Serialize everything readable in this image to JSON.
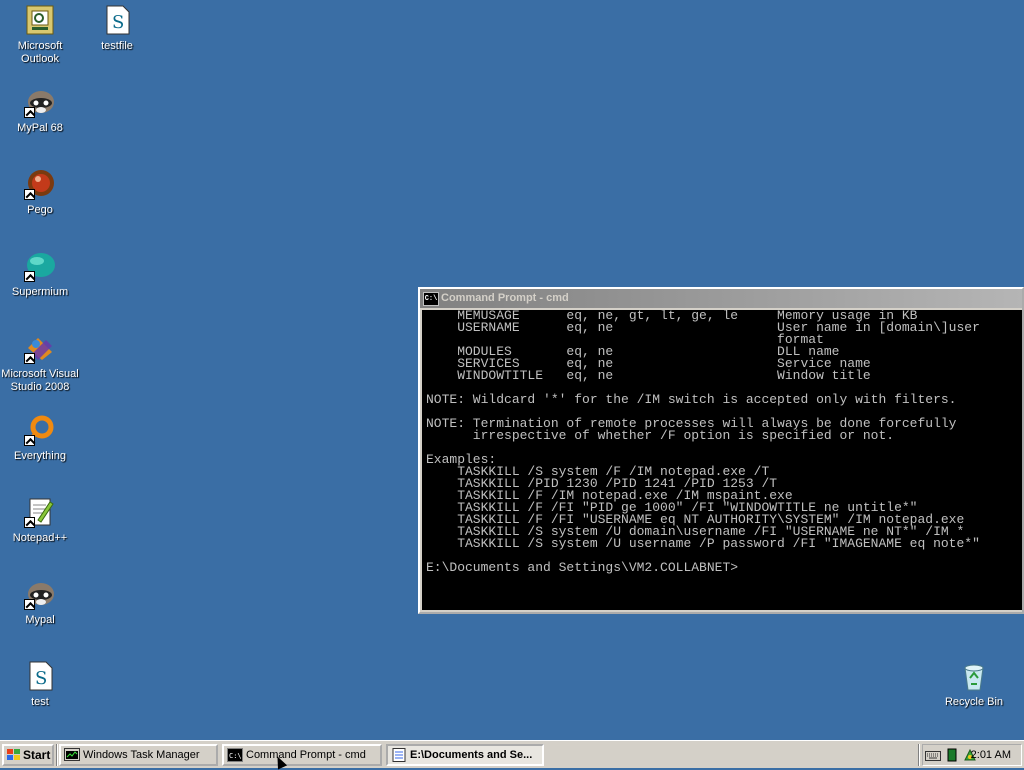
{
  "desktop": {
    "background": "#3a6ea5",
    "icons": [
      {
        "label": "Microsoft Outlook",
        "icon": "outlook-icon"
      },
      {
        "label": "testfile",
        "icon": "script-file-icon"
      },
      {
        "label": "MyPal 68",
        "icon": "mypal-raccoon-icon"
      },
      {
        "label": "Pego",
        "icon": "pego-icon"
      },
      {
        "label": "Supermium",
        "icon": "supermium-icon"
      },
      {
        "label": "Microsoft Visual Studio 2008",
        "icon": "visual-studio-icon"
      },
      {
        "label": "Everything",
        "icon": "everything-search-icon"
      },
      {
        "label": "Notepad++",
        "icon": "notepadpp-icon"
      },
      {
        "label": "Mypal",
        "icon": "mypal-raccoon-icon"
      },
      {
        "label": "test",
        "icon": "script-file-icon"
      },
      {
        "label": "Recycle Bin",
        "icon": "recycle-bin-icon"
      }
    ]
  },
  "cmd_window": {
    "title": "Command Prompt - cmd",
    "icon_text": "C:\\",
    "lines": [
      "    MEMUSAGE      eq, ne, gt, lt, ge, le     Memory usage in KB",
      "    USERNAME      eq, ne                     User name in [domain\\]user",
      "                                             format",
      "    MODULES       eq, ne                     DLL name",
      "    SERVICES      eq, ne                     Service name",
      "    WINDOWTITLE   eq, ne                     Window title",
      "",
      "NOTE: Wildcard '*' for the /IM switch is accepted only with filters.",
      "",
      "NOTE: Termination of remote processes will always be done forcefully",
      "      irrespective of whether /F option is specified or not.",
      "",
      "Examples:",
      "    TASKKILL /S system /F /IM notepad.exe /T",
      "    TASKKILL /PID 1230 /PID 1241 /PID 1253 /T",
      "    TASKKILL /F /IM notepad.exe /IM mspaint.exe",
      "    TASKKILL /F /FI \"PID ge 1000\" /FI \"WINDOWTITLE ne untitle*\"",
      "    TASKKILL /F /FI \"USERNAME eq NT AUTHORITY\\SYSTEM\" /IM notepad.exe",
      "    TASKKILL /S system /U domain\\username /FI \"USERNAME ne NT*\" /IM *",
      "    TASKKILL /S system /U username /P password /FI \"IMAGENAME eq note*\"",
      "",
      "E:\\Documents and Settings\\VM2.COLLABNET>"
    ]
  },
  "taskbar": {
    "start_label": "Start",
    "tasks": [
      {
        "label": "Windows Task Manager",
        "icon": "task-manager-icon",
        "active": false
      },
      {
        "label": "Command Prompt - cmd",
        "icon": "cmd-icon",
        "active": false
      },
      {
        "label": "E:\\Documents and Se...",
        "icon": "notepad-icon",
        "active": true
      }
    ],
    "clock": "2:01 AM"
  }
}
